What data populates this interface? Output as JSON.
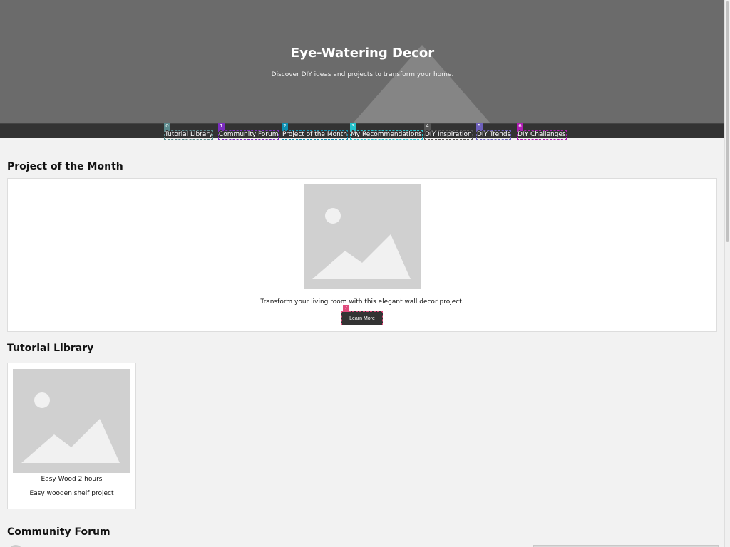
{
  "header": {
    "title": "Eye-Watering Decor",
    "subtitle": "Discover DIY ideas and projects to transform your home."
  },
  "nav": {
    "items": [
      {
        "tag": "0",
        "label": "Tutorial Library",
        "color": "#5b8a8d"
      },
      {
        "tag": "1",
        "label": "Community Forum",
        "color": "#7b2cbf"
      },
      {
        "tag": "2",
        "label": "Project of the Month",
        "color": "#0d8fb1"
      },
      {
        "tag": "3",
        "label": "My Recommendations",
        "color": "#25c2cc"
      },
      {
        "tag": "4",
        "label": "DIY Inspiration",
        "color": "#555555"
      },
      {
        "tag": "5",
        "label": "DIY Trends",
        "color": "#6d5fbb"
      },
      {
        "tag": "6",
        "label": "DIY Challenges",
        "color": "#b01cb3"
      }
    ]
  },
  "project_of_month": {
    "section_title": "Project of the Month",
    "description": "Transform your living room with this elegant wall decor project.",
    "button_tag": "7",
    "button_tag_color": "#e04b7c",
    "button_label": "Learn More"
  },
  "tutorial_library": {
    "section_title": "Tutorial Library",
    "cards": [
      {
        "meta": "Easy Wood 2 hours",
        "title": "Easy wooden shelf project"
      }
    ]
  },
  "community_forum": {
    "section_title": "Community Forum"
  }
}
